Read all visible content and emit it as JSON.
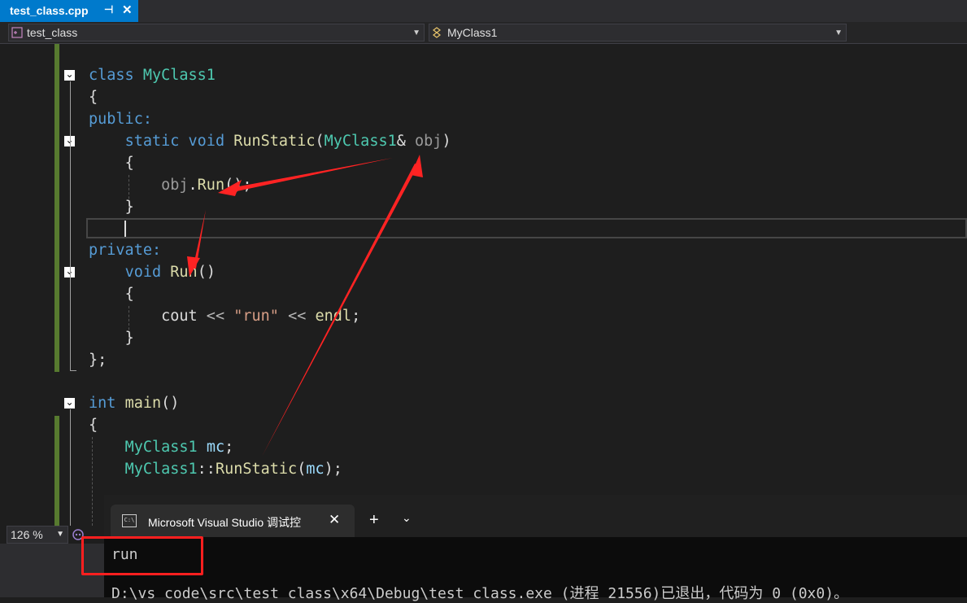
{
  "tab": {
    "title": "test_class.cpp",
    "pin_icon": "pin-icon",
    "close_glyph": "✕"
  },
  "nav": {
    "scope": "test_class",
    "member": "MyClass1"
  },
  "code": {
    "l1": {
      "kw": "class",
      "ty": "MyClass1"
    },
    "l2": "{",
    "l3": "public:",
    "l4": {
      "kw1": "static",
      "kw2": "void",
      "fn": "RunStatic",
      "p1": "(",
      "ty": "MyClass1",
      "amp": "&",
      "pa": "obj",
      "p2": ")"
    },
    "l5": "{",
    "l6": {
      "pa": "obj",
      "dot": ".",
      "fn": "Run",
      "rest": "();"
    },
    "l7": "}",
    "l9": "private:",
    "l10": {
      "kw": "void",
      "fn": "Run",
      "rest": "()"
    },
    "l11": "{",
    "l12": {
      "a": "cout",
      "op1": " << ",
      "st": "\"run\"",
      "op2": " << ",
      "b": "endl",
      "semi": ";"
    },
    "l13": "}",
    "l14": "};",
    "l16": {
      "kw": "int",
      "fn": "main",
      "rest": "()"
    },
    "l17": "{",
    "l18": {
      "ty": "MyClass1",
      "va": "mc",
      "semi": ";"
    },
    "l19": {
      "ty": "MyClass1",
      "sep": "::",
      "fn": "RunStatic",
      "p1": "(",
      "va": "mc",
      "p2": ");"
    }
  },
  "zoom": {
    "value": "126 %"
  },
  "console": {
    "tab_title": "Microsoft Visual Studio 调试控",
    "close_glyph": "✕",
    "plus": "+",
    "chevron": "⌄",
    "icon_text": "C:\\",
    "output1": "run",
    "output2": "D:\\vs code\\src\\test class\\x64\\Debug\\test class.exe (进程 21556)已退出，代码为 0 (0x0)。"
  },
  "colors": {
    "accent": "#007acc",
    "annotation_red": "#ff1f1f"
  }
}
